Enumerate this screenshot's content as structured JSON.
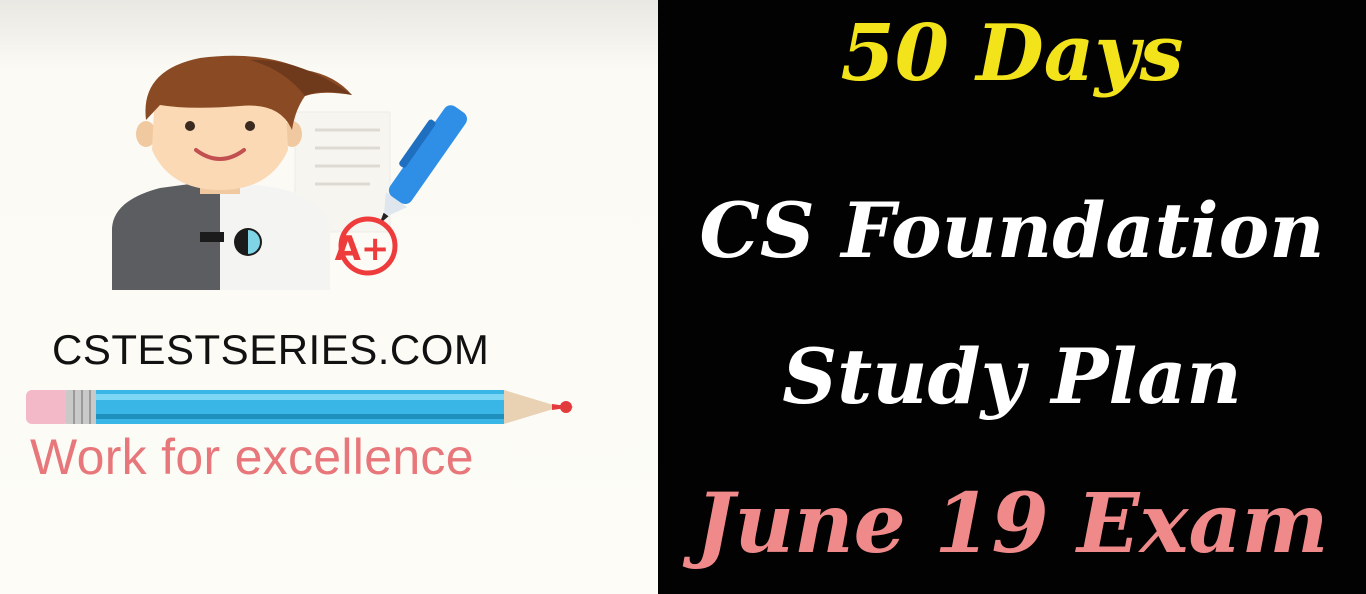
{
  "branding": {
    "site": "CSTESTSERIES.COM",
    "tagline": "Work for excellence",
    "grade_badge": "A+"
  },
  "headline": {
    "line1": "50 Days",
    "line2": "CS Foundation",
    "line3": "Study Plan",
    "line4": "June 19 Exam"
  },
  "icons": [
    "student-avatar-icon",
    "pen-icon",
    "grade-badge-icon",
    "pencil-icon"
  ],
  "colors": {
    "left_background": "#fdfcf6",
    "right_background": "#020202",
    "line1_yellow": "#f3e31b",
    "line2_white": "#ffffff",
    "line3_white": "#ffffff",
    "line4_pink": "#f08a8a",
    "tagline_pink": "#e7777a",
    "site_text": "#111111",
    "pen_blue": "#2f8fe6",
    "badge_red": "#ee3b3b",
    "pencil_blue": "#3ab6e6"
  }
}
